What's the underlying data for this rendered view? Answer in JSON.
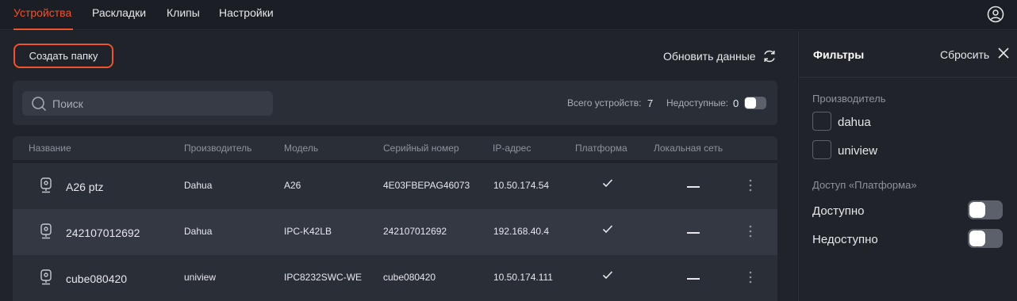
{
  "nav": {
    "tabs": [
      {
        "label": "Устройства",
        "active": true
      },
      {
        "label": "Раскладки",
        "active": false
      },
      {
        "label": "Клипы",
        "active": false
      },
      {
        "label": "Настройки",
        "active": false
      }
    ],
    "user_icon": "user-circle-icon"
  },
  "toolbar": {
    "create_folder_label": "Создать папку",
    "refresh_label": "Обновить данные",
    "refresh_icon": "refresh-icon"
  },
  "search": {
    "placeholder": "Поиск",
    "value": ""
  },
  "stats": {
    "total_label": "Всего устройств:",
    "total_value": "7",
    "unavailable_label": "Недоступные:",
    "unavailable_value": "0",
    "unavailable_toggle_on": false
  },
  "table": {
    "columns": [
      "Название",
      "Производитель",
      "Модель",
      "Серийный номер",
      "IP-адрес",
      "Платформа",
      "Локальная сеть"
    ],
    "rows": [
      {
        "name": "A26 ptz",
        "vendor": "Dahua",
        "model": "A26",
        "serial": "4E03FBEPAG46073",
        "ip": "10.50.174.54",
        "platform": true,
        "local": "—"
      },
      {
        "name": "242107012692",
        "vendor": "Dahua",
        "model": "IPC-K42LB",
        "serial": "242107012692",
        "ip": "192.168.40.4",
        "platform": true,
        "local": "—"
      },
      {
        "name": "cube080420",
        "vendor": "uniview",
        "model": "IPC8232SWC-WE",
        "serial": "cube080420",
        "ip": "10.50.174.111",
        "platform": true,
        "local": "—"
      }
    ]
  },
  "filters": {
    "title": "Фильтры",
    "reset_label": "Сбросить",
    "vendor_section": "Производитель",
    "vendors": [
      {
        "label": "dahua",
        "checked": false
      },
      {
        "label": "uniview",
        "checked": false
      }
    ],
    "access_section": "Доступ «Платформа»",
    "access": [
      {
        "label": "Доступно",
        "on": false
      },
      {
        "label": "Недоступно",
        "on": false
      }
    ]
  },
  "colors": {
    "accent": "#f0522c",
    "background": "#1b1e24",
    "panel": "#2a2e36"
  }
}
